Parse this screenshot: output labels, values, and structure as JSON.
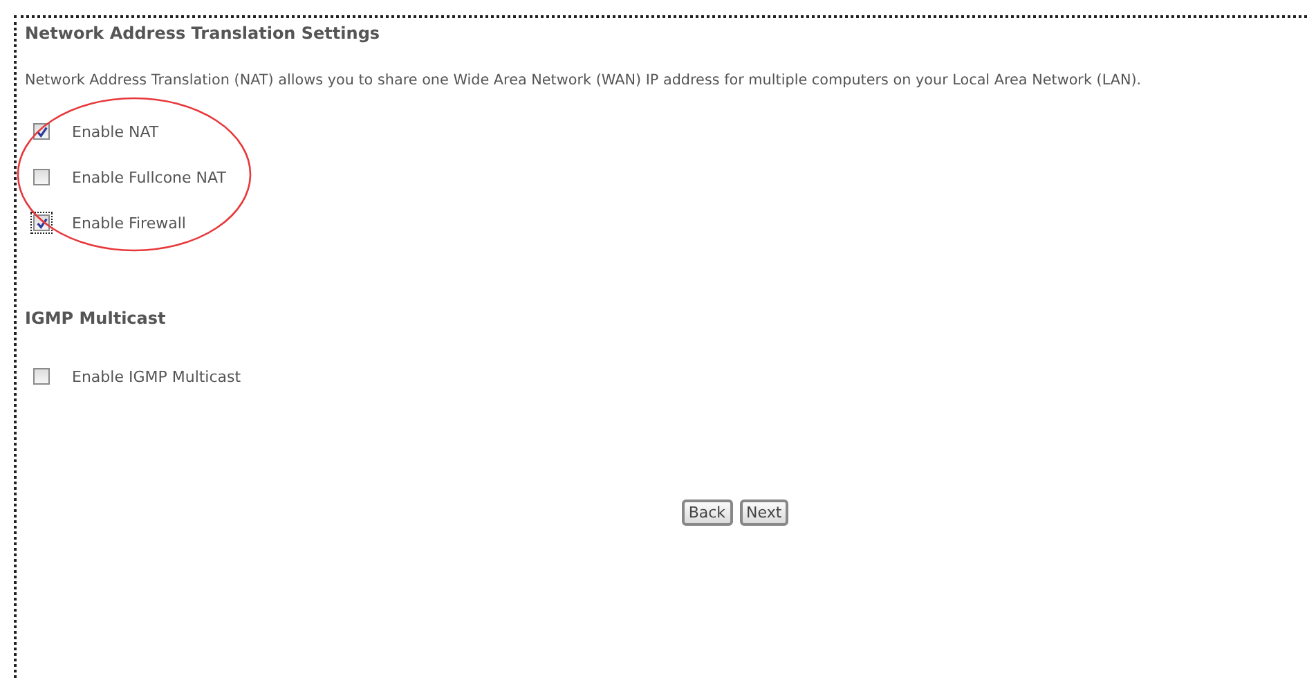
{
  "nat_section": {
    "title": "Network Address Translation Settings",
    "description": "Network Address Translation (NAT) allows you to share one Wide Area Network (WAN) IP address for multiple computers on your Local Area Network (LAN).",
    "options": [
      {
        "label": "Enable NAT",
        "checked": true,
        "focused": false
      },
      {
        "label": "Enable Fullcone NAT",
        "checked": false,
        "focused": false
      },
      {
        "label": "Enable Firewall",
        "checked": true,
        "focused": true
      }
    ]
  },
  "igmp_section": {
    "title": "IGMP Multicast",
    "options": [
      {
        "label": "Enable IGMP Multicast",
        "checked": false,
        "focused": false
      }
    ]
  },
  "buttons": [
    "Back",
    "Next"
  ]
}
